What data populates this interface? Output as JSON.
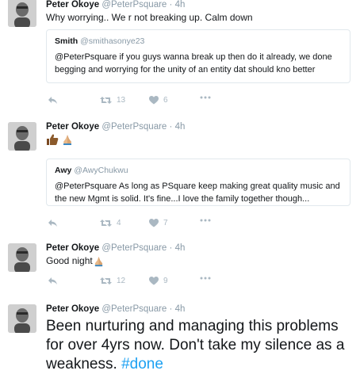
{
  "tweets": [
    {
      "name": "Peter Okoye",
      "handle": "@PeterPsquare",
      "sep": "·",
      "time": "4h",
      "text": "Why worrying.. We r not breaking up. Calm down",
      "quote": {
        "name": "Smith",
        "handle": "@smithasonye23",
        "text": "@PeterPsquare if you guys wanna break up then do it already, we done begging and worrying for the unity of an entity dat should kno better"
      },
      "retweets": "13",
      "likes": "6"
    },
    {
      "name": "Peter Okoye",
      "handle": "@PeterPsquare",
      "sep": "·",
      "time": "4h",
      "emoji_icons": [
        "thumbs-up-icon",
        "praying-hands-icon"
      ],
      "quote": {
        "name": "Awy",
        "handle": "@AwyChukwu",
        "text": "@PeterPsquare As long as PSquare keep making great quality music and the new Mgmt is solid. It's fine...I love the family together though..."
      },
      "retweets": "4",
      "likes": "7"
    },
    {
      "name": "Peter Okoye",
      "handle": "@PeterPsquare",
      "sep": "·",
      "time": "4h",
      "text": "Good night",
      "emoji_icons": [
        "praying-hands-icon"
      ],
      "retweets": "12",
      "likes": "9"
    },
    {
      "name": "Peter Okoye",
      "handle": "@PeterPsquare",
      "sep": "·",
      "time": "4h",
      "text": "Been nurturing and managing this problems for over 4yrs now. Don't take my silence as a weakness.",
      "hashtag": "#done"
    }
  ],
  "colors": {
    "link": "#1da1f2",
    "muted": "#8899a6",
    "icon": "#aab8c2",
    "border": "#e1e8ed"
  }
}
